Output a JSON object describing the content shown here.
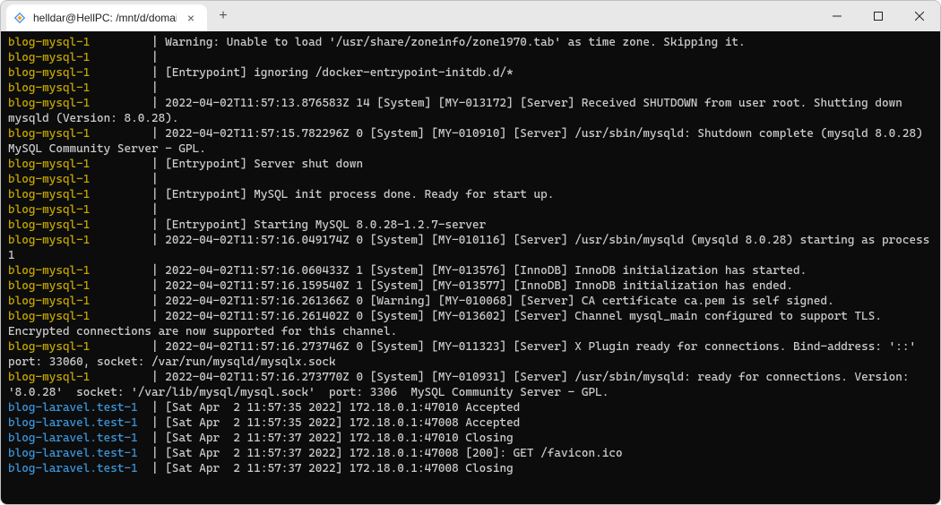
{
  "titlebar": {
    "tab_title": "helldar@HellPC: /mnt/d/domain",
    "close_glyph": "×",
    "new_tab_glyph": "+"
  },
  "terminal": {
    "lines": [
      {
        "prefix": "blog-mysql-1",
        "prefix_class": "c-yellow",
        "sep": "  | ",
        "text": "Warning: Unable to load '/usr/share/zoneinfo/zone1970.tab' as time zone. Skipping it."
      },
      {
        "prefix": "blog-mysql-1",
        "prefix_class": "c-yellow",
        "sep": "  | ",
        "text": ""
      },
      {
        "prefix": "blog-mysql-1",
        "prefix_class": "c-yellow",
        "sep": "  | ",
        "text": "[Entrypoint] ignoring /docker-entrypoint-initdb.d/*"
      },
      {
        "prefix": "blog-mysql-1",
        "prefix_class": "c-yellow",
        "sep": "  | ",
        "text": ""
      },
      {
        "prefix": "blog-mysql-1",
        "prefix_class": "c-yellow",
        "sep": "  | ",
        "text": "2022-04-02T11:57:13.876583Z 14 [System] [MY-013172] [Server] Received SHUTDOWN from user root. Shutting down mysqld (Version: 8.0.28)."
      },
      {
        "prefix": "blog-mysql-1",
        "prefix_class": "c-yellow",
        "sep": "  | ",
        "text": "2022-04-02T11:57:15.782296Z 0 [System] [MY-010910] [Server] /usr/sbin/mysqld: Shutdown complete (mysqld 8.0.28)  MySQL Community Server - GPL."
      },
      {
        "prefix": "blog-mysql-1",
        "prefix_class": "c-yellow",
        "sep": "  | ",
        "text": "[Entrypoint] Server shut down"
      },
      {
        "prefix": "blog-mysql-1",
        "prefix_class": "c-yellow",
        "sep": "  | ",
        "text": ""
      },
      {
        "prefix": "blog-mysql-1",
        "prefix_class": "c-yellow",
        "sep": "  | ",
        "text": "[Entrypoint] MySQL init process done. Ready for start up."
      },
      {
        "prefix": "blog-mysql-1",
        "prefix_class": "c-yellow",
        "sep": "  | ",
        "text": ""
      },
      {
        "prefix": "blog-mysql-1",
        "prefix_class": "c-yellow",
        "sep": "  | ",
        "text": "[Entrypoint] Starting MySQL 8.0.28-1.2.7-server"
      },
      {
        "prefix": "blog-mysql-1",
        "prefix_class": "c-yellow",
        "sep": "  | ",
        "text": "2022-04-02T11:57:16.049174Z 0 [System] [MY-010116] [Server] /usr/sbin/mysqld (mysqld 8.0.28) starting as process 1"
      },
      {
        "prefix": "blog-mysql-1",
        "prefix_class": "c-yellow",
        "sep": "  | ",
        "text": "2022-04-02T11:57:16.060433Z 1 [System] [MY-013576] [InnoDB] InnoDB initialization has started."
      },
      {
        "prefix": "blog-mysql-1",
        "prefix_class": "c-yellow",
        "sep": "  | ",
        "text": "2022-04-02T11:57:16.159540Z 1 [System] [MY-013577] [InnoDB] InnoDB initialization has ended."
      },
      {
        "prefix": "blog-mysql-1",
        "prefix_class": "c-yellow",
        "sep": "  | ",
        "text": "2022-04-02T11:57:16.261366Z 0 [Warning] [MY-010068] [Server] CA certificate ca.pem is self signed."
      },
      {
        "prefix": "blog-mysql-1",
        "prefix_class": "c-yellow",
        "sep": "  | ",
        "text": "2022-04-02T11:57:16.261402Z 0 [System] [MY-013602] [Server] Channel mysql_main configured to support TLS. Encrypted connections are now supported for this channel."
      },
      {
        "prefix": "blog-mysql-1",
        "prefix_class": "c-yellow",
        "sep": "  | ",
        "text": "2022-04-02T11:57:16.273746Z 0 [System] [MY-011323] [Server] X Plugin ready for connections. Bind-address: '::' port: 33060, socket: /var/run/mysqld/mysqlx.sock"
      },
      {
        "prefix": "blog-mysql-1",
        "prefix_class": "c-yellow",
        "sep": "  | ",
        "text": "2022-04-02T11:57:16.273770Z 0 [System] [MY-010931] [Server] /usr/sbin/mysqld: ready for connections. Version: '8.0.28'  socket: '/var/lib/mysql/mysql.sock'  port: 3306  MySQL Community Server - GPL."
      },
      {
        "prefix": "blog-laravel.test-1",
        "prefix_class": "c-cyan",
        "sep": "  | ",
        "text": "[Sat Apr  2 11:57:35 2022] 172.18.0.1:47010 Accepted"
      },
      {
        "prefix": "blog-laravel.test-1",
        "prefix_class": "c-cyan",
        "sep": "  | ",
        "text": "[Sat Apr  2 11:57:35 2022] 172.18.0.1:47008 Accepted"
      },
      {
        "prefix": "blog-laravel.test-1",
        "prefix_class": "c-cyan",
        "sep": "  | ",
        "text": "[Sat Apr  2 11:57:37 2022] 172.18.0.1:47010 Closing"
      },
      {
        "prefix": "blog-laravel.test-1",
        "prefix_class": "c-cyan",
        "sep": "  | ",
        "text": "[Sat Apr  2 11:57:37 2022] 172.18.0.1:47008 [200]: GET /favicon.ico"
      },
      {
        "prefix": "blog-laravel.test-1",
        "prefix_class": "c-cyan",
        "sep": "  | ",
        "text": "[Sat Apr  2 11:57:37 2022] 172.18.0.1:47008 Closing"
      }
    ]
  }
}
